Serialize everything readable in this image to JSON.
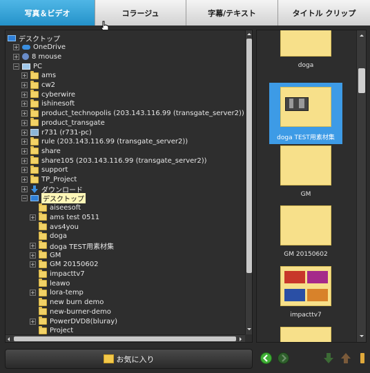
{
  "tabs": [
    {
      "label": "写真＆ビデオ"
    },
    {
      "label": "コラージュ"
    },
    {
      "label": "字幕/テキスト"
    },
    {
      "label": "タイトル クリップ"
    }
  ],
  "tree": [
    {
      "label": "デスクトップ",
      "icon": "desktop-icon",
      "expander": "",
      "level": 0
    },
    {
      "label": "OneDrive",
      "icon": "cloud-icon",
      "expander": "+",
      "level": 1
    },
    {
      "label": "8 mouse",
      "icon": "user-icon",
      "expander": "+",
      "level": 1
    },
    {
      "label": "PC",
      "icon": "pc-icon",
      "expander": "−",
      "level": 1
    },
    {
      "label": "ams",
      "icon": "folder-icon",
      "expander": "+",
      "level": 2
    },
    {
      "label": "cw2",
      "icon": "folder-icon",
      "expander": "+",
      "level": 2
    },
    {
      "label": "cyberwire",
      "icon": "folder-icon",
      "expander": "+",
      "level": 2
    },
    {
      "label": "ishinesoft",
      "icon": "folder-icon",
      "expander": "+",
      "level": 2
    },
    {
      "label": "product_technopolis (203.143.116.99 (transgate_server2))",
      "icon": "folder-icon",
      "expander": "+",
      "level": 2
    },
    {
      "label": "product_transgate",
      "icon": "folder-icon",
      "expander": "+",
      "level": 2
    },
    {
      "label": "r731 (r731-pc)",
      "icon": "network-drive-icon",
      "expander": "+",
      "level": 2
    },
    {
      "label": "rule (203.143.116.99 (transgate_server2))",
      "icon": "folder-icon",
      "expander": "+",
      "level": 2
    },
    {
      "label": "share",
      "icon": "folder-icon",
      "expander": "+",
      "level": 2
    },
    {
      "label": "share105 (203.143.116.99 (transgate_server2))",
      "icon": "folder-icon",
      "expander": "+",
      "level": 2
    },
    {
      "label": "support",
      "icon": "folder-icon",
      "expander": "+",
      "level": 2
    },
    {
      "label": "TP_Project",
      "icon": "folder-icon",
      "expander": "+",
      "level": 2
    },
    {
      "label": "ダウンロード",
      "icon": "download-icon",
      "expander": "+",
      "level": 2
    },
    {
      "label": "デスクトップ",
      "icon": "desktop-icon",
      "expander": "−",
      "level": 2,
      "selected": true
    },
    {
      "label": "aiseesoft",
      "icon": "folder-icon",
      "expander": "",
      "level": 3
    },
    {
      "label": "ams test 0511",
      "icon": "folder-icon",
      "expander": "+",
      "level": 3
    },
    {
      "label": "avs4you",
      "icon": "folder-icon",
      "expander": "",
      "level": 3
    },
    {
      "label": "doga",
      "icon": "folder-icon",
      "expander": "",
      "level": 3
    },
    {
      "label": "doga TEST用素材集",
      "icon": "folder-icon",
      "expander": "+",
      "level": 3
    },
    {
      "label": "GM",
      "icon": "folder-icon",
      "expander": "+",
      "level": 3
    },
    {
      "label": "GM 20150602",
      "icon": "folder-icon",
      "expander": "+",
      "level": 3
    },
    {
      "label": "impacttv7",
      "icon": "folder-icon",
      "expander": "",
      "level": 3
    },
    {
      "label": "leawo",
      "icon": "folder-icon",
      "expander": "",
      "level": 3
    },
    {
      "label": "lora-temp",
      "icon": "folder-icon",
      "expander": "+",
      "level": 3
    },
    {
      "label": "new burn demo",
      "icon": "folder-icon",
      "expander": "",
      "level": 3
    },
    {
      "label": "new-burner-demo",
      "icon": "folder-icon",
      "expander": "",
      "level": 3
    },
    {
      "label": "PowerDVD8(bluray)",
      "icon": "folder-icon",
      "expander": "+",
      "level": 3
    },
    {
      "label": "Project",
      "icon": "folder-icon",
      "expander": "",
      "level": 3
    }
  ],
  "thumbnails": [
    {
      "caption": "doga",
      "selected": false,
      "preview": "folder"
    },
    {
      "caption": "doga TEST用素材集",
      "selected": true,
      "preview": "folder-with-images"
    },
    {
      "caption": "GM",
      "selected": false,
      "preview": "folder"
    },
    {
      "caption": "GM 20150602",
      "selected": false,
      "preview": "folder"
    },
    {
      "caption": "impacttv7",
      "selected": false,
      "preview": "folder-with-images"
    },
    {
      "caption": "",
      "selected": false,
      "preview": "folder"
    }
  ],
  "favorites": {
    "label": "お気に入り",
    "icon": "favorites-folder-icon"
  },
  "colors": {
    "tab_active": "#2492c9",
    "selection": "#3d9be6",
    "tree_selection": "#fff7b8"
  }
}
